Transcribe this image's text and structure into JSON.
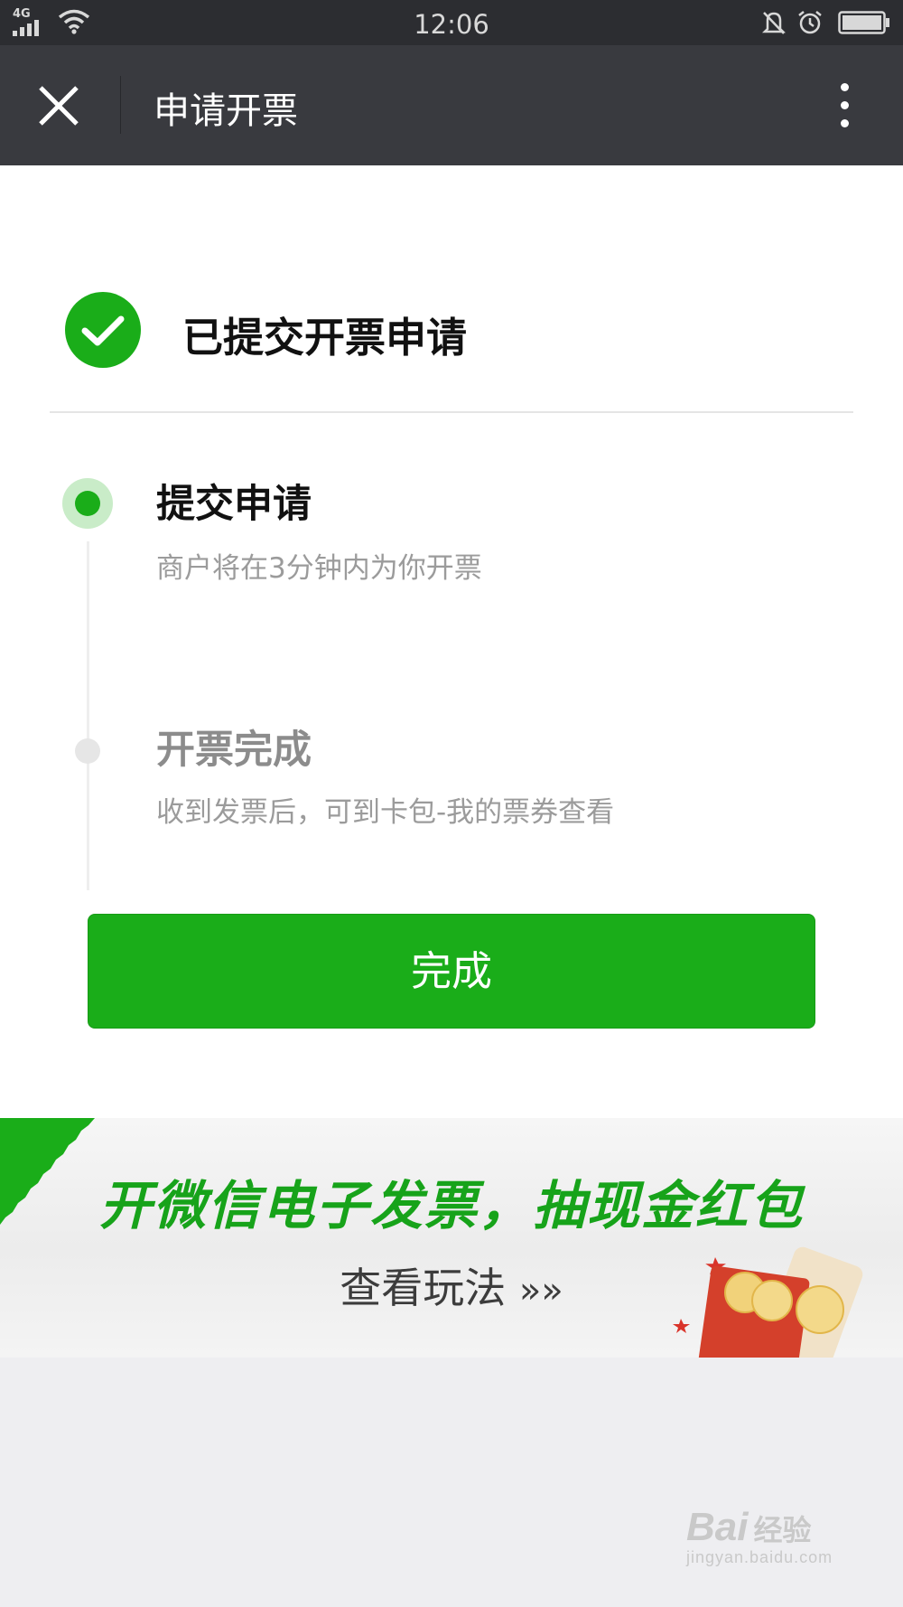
{
  "status_bar": {
    "network": "4G",
    "time": "12:06",
    "icons": [
      "signal-icon",
      "wifi-icon",
      "bell-muted-icon",
      "alarm-icon",
      "battery-icon"
    ]
  },
  "nav": {
    "title": "申请开票",
    "close_icon": "close-icon",
    "menu_icon": "more-vertical-icon"
  },
  "result": {
    "title": "已提交开票申请",
    "icon": "check-circle-icon"
  },
  "steps": [
    {
      "title": "提交申请",
      "desc": "商户将在3分钟内为你开票",
      "state": "active"
    },
    {
      "title": "开票完成",
      "desc": "收到发票后，可到卡包-我的票券查看",
      "state": "pending"
    }
  ],
  "done_button": {
    "label": "完成"
  },
  "banner": {
    "headline": "开微信电子发票，抽现金红包",
    "link_text": "查看玩法",
    "link_arrows": "»»"
  },
  "watermark": {
    "brand": "Bai",
    "brand_suffix": "经验",
    "url": "jingyan.baidu.com"
  },
  "colors": {
    "status_bar_bg": "#2c2d31",
    "nav_bg": "#393a3f",
    "accent_green": "#1aad19",
    "page_bg": "#eeeef1"
  }
}
